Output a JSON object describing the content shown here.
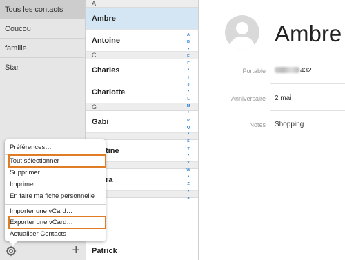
{
  "groups": [
    {
      "label": "Tous les contacts",
      "selected": true
    },
    {
      "label": "Coucou",
      "selected": false
    },
    {
      "label": "famille",
      "selected": false
    },
    {
      "label": "Star",
      "selected": false
    }
  ],
  "footer": {
    "gear_icon": "gear-icon",
    "add_label": "+"
  },
  "list": {
    "sections": [
      {
        "letter": "A",
        "rows": [
          "Ambre",
          "Antoine"
        ]
      },
      {
        "letter": "C",
        "rows": [
          "Charles",
          "Charlotte"
        ]
      },
      {
        "letter": "G",
        "rows": [
          "Gabi"
        ]
      }
    ],
    "partial_rows": [
      "tine",
      "ra"
    ],
    "bottom_row": "Patrick",
    "selected": "Ambre"
  },
  "index": [
    "A",
    "B",
    "•",
    "E",
    "F",
    "•",
    "I",
    "J",
    "•",
    "L",
    "M",
    "•",
    "P",
    "Q",
    "•",
    "S",
    "T",
    "•",
    "V",
    "W",
    "•",
    "Z",
    "•",
    "#"
  ],
  "menu": {
    "items": [
      "Préférences…",
      "Tout sélectionner",
      "Supprimer",
      "Imprimer",
      "En faire ma fiche personnelle",
      "Importer une vCard…",
      "Exporter une vCard…",
      "Actualiser Contacts"
    ],
    "highlighted": [
      "Tout sélectionner",
      "Exporter une vCard…"
    ],
    "highlight_color": "#e07b26"
  },
  "detail": {
    "name": "Ambre",
    "fields": [
      {
        "label": "Portable",
        "value": "432",
        "partly_blurred": true
      },
      {
        "label": "Anniversaire",
        "value": "2 mai"
      },
      {
        "label": "Notes",
        "value": "Shopping"
      }
    ]
  },
  "colors": {
    "selection_blue": "#d4e6f3",
    "index_blue": "#2a7fd4",
    "sidebar_gray": "#e6e6e6"
  }
}
